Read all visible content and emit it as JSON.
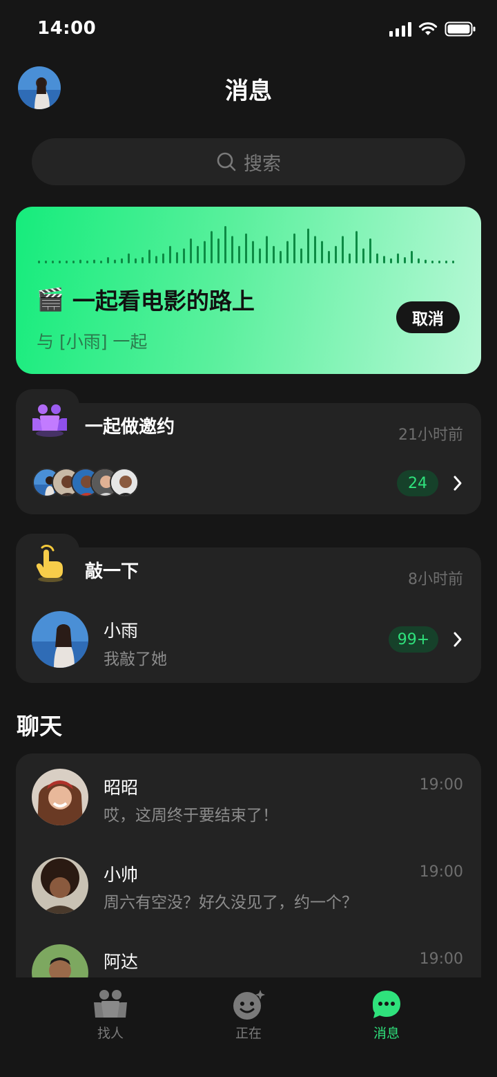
{
  "status_bar": {
    "time": "14:00"
  },
  "header": {
    "title": "消息"
  },
  "search": {
    "placeholder": "搜索"
  },
  "banner": {
    "title": "一起看电影的路上",
    "emoji": "🎬",
    "subtitle": "与 [小雨] 一起",
    "cancel_label": "取消",
    "accent_color": "#16ec7c"
  },
  "invite_card": {
    "title": "一起做邀约",
    "time": "21小时前",
    "count": "24",
    "icon": "people-icon"
  },
  "poke_card": {
    "title": "敲一下",
    "time": "8小时前",
    "name": "小雨",
    "preview": "我敲了她",
    "count": "99+",
    "icon": "hand-tap-icon"
  },
  "chat_section": {
    "title": "聊天"
  },
  "chats": [
    {
      "name": "昭昭",
      "preview": "哎，这周终于要结束了！",
      "time": "19:00"
    },
    {
      "name": "小帅",
      "preview": "周六有空没？好久没见了，约一个？",
      "time": "19:00"
    },
    {
      "name": "阿达",
      "preview": "",
      "time": "19:00"
    }
  ],
  "tabbar": {
    "items": [
      {
        "label": "找人",
        "icon": "people-icon"
      },
      {
        "label": "正在",
        "icon": "smile-sparkle-icon"
      },
      {
        "label": "消息",
        "icon": "chat-bubble-icon"
      }
    ],
    "active_color": "#2fe27c"
  }
}
